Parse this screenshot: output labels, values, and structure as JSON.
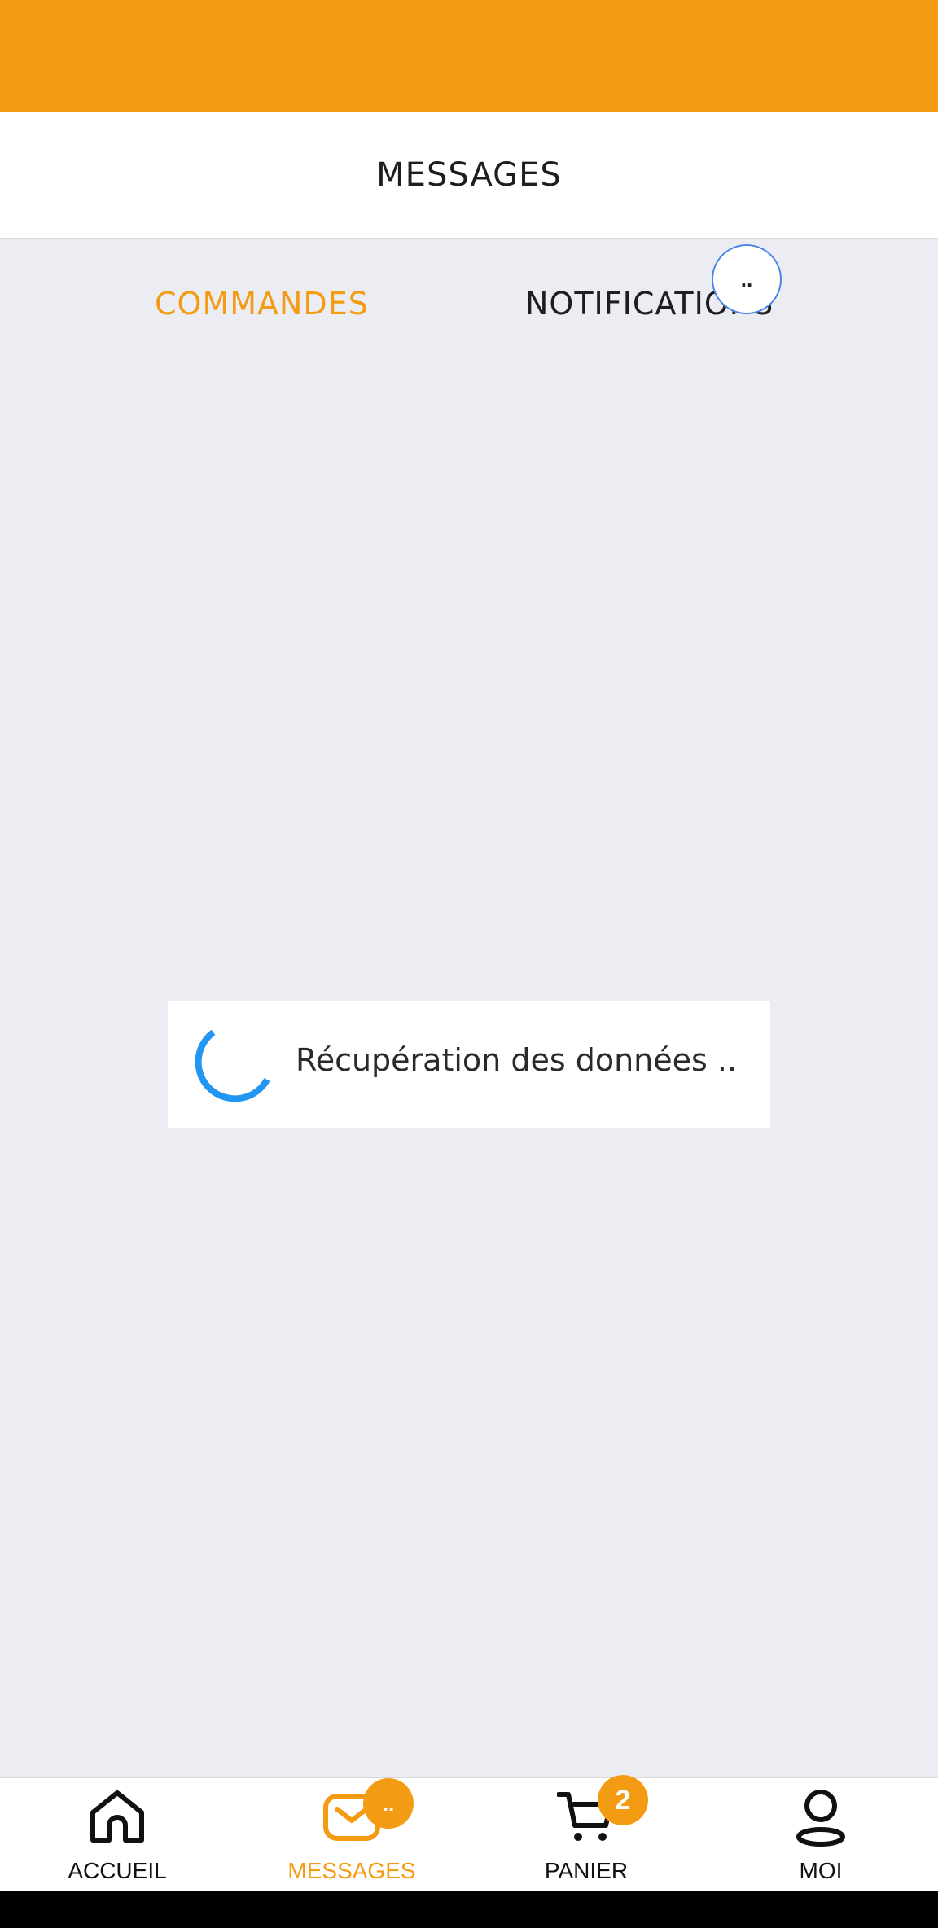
{
  "header": {
    "title": "MESSAGES"
  },
  "tabs": [
    {
      "label": "COMMANDES",
      "active": true
    },
    {
      "label": "NOTIFICATIONS",
      "active": false
    }
  ],
  "tab_badge": "..",
  "loading": {
    "text": "Récupération des données .."
  },
  "bottom_nav": [
    {
      "label": "ACCUEIL",
      "icon": "home-icon",
      "active": false
    },
    {
      "label": "MESSAGES",
      "icon": "mail-icon",
      "active": true,
      "badge": ".."
    },
    {
      "label": "PANIER",
      "icon": "cart-icon",
      "active": false,
      "badge": "2"
    },
    {
      "label": "MOI",
      "icon": "user-icon",
      "active": false
    }
  ],
  "colors": {
    "accent": "#F39C13",
    "background": "#ECECF3",
    "spinner": "#2196F3",
    "badge_outline": "#4A86E8"
  }
}
